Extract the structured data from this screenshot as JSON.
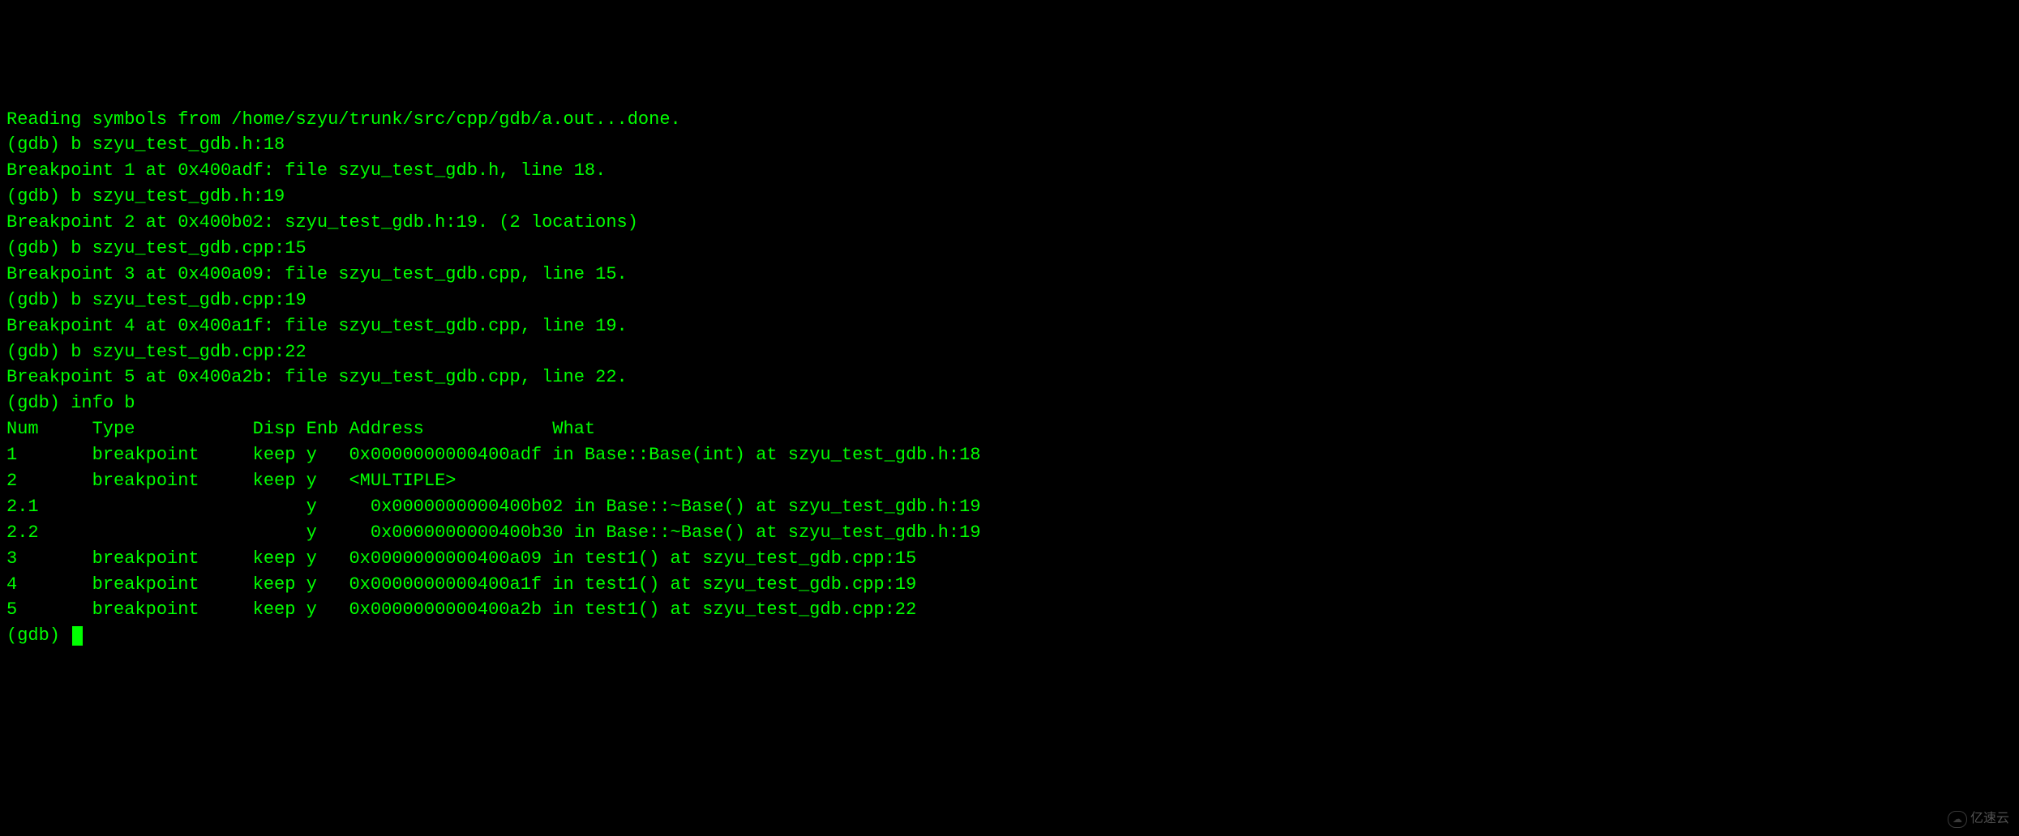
{
  "lines": {
    "l0": "Reading symbols from /home/szyu/trunk/src/cpp/gdb/a.out...done.",
    "l1": "(gdb) b szyu_test_gdb.h:18",
    "l2": "Breakpoint 1 at 0x400adf: file szyu_test_gdb.h, line 18.",
    "l3": "(gdb) b szyu_test_gdb.h:19",
    "l4": "Breakpoint 2 at 0x400b02: szyu_test_gdb.h:19. (2 locations)",
    "l5": "(gdb) b szyu_test_gdb.cpp:15",
    "l6": "Breakpoint 3 at 0x400a09: file szyu_test_gdb.cpp, line 15.",
    "l7": "(gdb) b szyu_test_gdb.cpp:19",
    "l8": "Breakpoint 4 at 0x400a1f: file szyu_test_gdb.cpp, line 19.",
    "l9": "(gdb) b szyu_test_gdb.cpp:22",
    "l10": "Breakpoint 5 at 0x400a2b: file szyu_test_gdb.cpp, line 22.",
    "l11": "(gdb) info b",
    "l12": "Num     Type           Disp Enb Address            What",
    "l13": "1       breakpoint     keep y   0x0000000000400adf in Base::Base(int) at szyu_test_gdb.h:18",
    "l14": "2       breakpoint     keep y   <MULTIPLE>         ",
    "l15": "2.1                         y     0x0000000000400b02 in Base::~Base() at szyu_test_gdb.h:19",
    "l16": "2.2                         y     0x0000000000400b30 in Base::~Base() at szyu_test_gdb.h:19",
    "l17": "3       breakpoint     keep y   0x0000000000400a09 in test1() at szyu_test_gdb.cpp:15",
    "l18": "4       breakpoint     keep y   0x0000000000400a1f in test1() at szyu_test_gdb.cpp:19",
    "l19": "5       breakpoint     keep y   0x0000000000400a2b in test1() at szyu_test_gdb.cpp:22",
    "l20": "(gdb) "
  },
  "watermark": {
    "text": "亿速云"
  }
}
